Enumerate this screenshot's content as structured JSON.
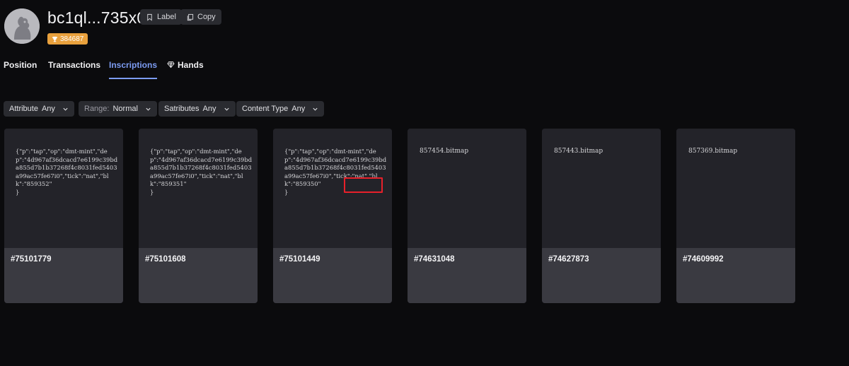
{
  "profile": {
    "address": "bc1ql...735x0",
    "label_button": "Label",
    "copy_button": "Copy",
    "rank_badge": "384687"
  },
  "tabs": [
    {
      "label": "Position",
      "active": false
    },
    {
      "label": "Transactions",
      "active": false
    },
    {
      "label": "Inscriptions",
      "active": true
    },
    {
      "label": "Hands",
      "active": false
    }
  ],
  "filters": {
    "attribute": {
      "label": "Attribute",
      "value": "Any"
    },
    "range": {
      "label": "Range:",
      "value": "Normal"
    },
    "satributes": {
      "label": "Satributes",
      "value": "Any"
    },
    "content_type": {
      "label": "Content Type",
      "value": "Any"
    }
  },
  "inscriptions": [
    {
      "content": "{\"p\":\"tap\",\"op\":\"dmt-mint\",\"dep\":\"4d967af36dcacd7e6199c39bda855d7b1b37268f4c8031fed5403a99ac57fe67i0\",\"tick\":\"nat\",\"blk\":\"859352\"\n}",
      "number": "#75101779"
    },
    {
      "content": "{\"p\":\"tap\",\"op\":\"dmt-mint\",\"dep\":\"4d967af36dcacd7e6199c39bda855d7b1b37268f4c8031fed5403a99ac57fe67i0\",\"tick\":\"nat\",\"blk\":\"859351\"\n}",
      "number": "#75101608"
    },
    {
      "content": "{\"p\":\"tap\",\"op\":\"dmt-mint\",\"dep\":\"4d967af36dcacd7e6199c39bda855d7b1b37268f4c8031fed5403a99ac57fe67i0\",\"tick\":\"nat\",\"blk\":\"859350\"\n}",
      "number": "#75101449"
    },
    {
      "content": "857454.bitmap",
      "number": "#74631048"
    },
    {
      "content": "857443.bitmap",
      "number": "#74627873"
    },
    {
      "content": "857369.bitmap",
      "number": "#74609992"
    }
  ],
  "colors": {
    "background": "#0b0b0d",
    "accent": "#7c9cf2",
    "badge": "#e9a13d",
    "highlight": "#e8202a"
  }
}
